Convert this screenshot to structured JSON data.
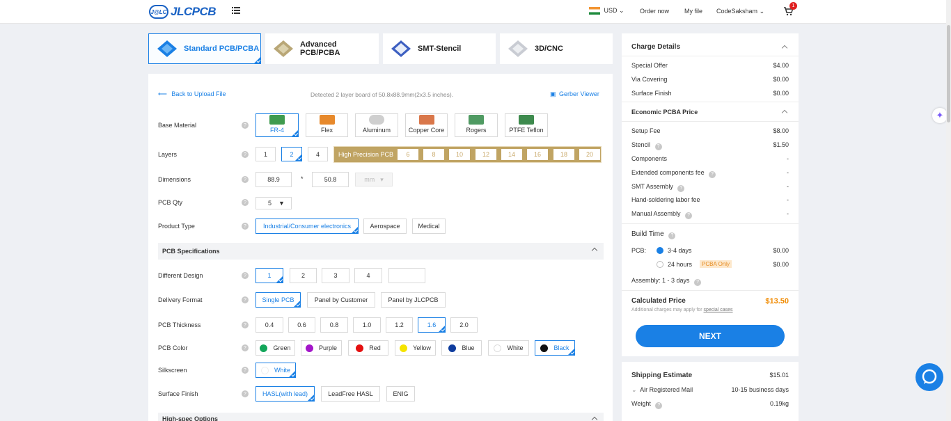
{
  "header": {
    "logo_badge": "J@LC",
    "logo_text": "JLCPCB",
    "currency": "USD",
    "order_now": "Order now",
    "my_file": "My file",
    "user": "CodeSaksham",
    "cart_count": "1"
  },
  "tabs": [
    "Standard PCB/PCBA",
    "Advanced PCB/PCBA",
    "SMT-Stencil",
    "3D/CNC"
  ],
  "upload": {
    "back": "Back to Upload File",
    "detected": "Detected 2 layer board of 50.8x88.9mm(2x3.5 inches).",
    "gerber": "Gerber Viewer"
  },
  "form": {
    "base_material": {
      "label": "Base Material",
      "options": [
        "FR-4",
        "Flex",
        "Aluminum",
        "Copper Core",
        "Rogers",
        "PTFE Teflon"
      ]
    },
    "layers": {
      "label": "Layers",
      "options": [
        "1",
        "2",
        "4"
      ],
      "hp_label": "High Precision PCB",
      "hp_options": [
        "6",
        "8",
        "10",
        "12",
        "14",
        "16",
        "18",
        "20"
      ]
    },
    "dimensions": {
      "label": "Dimensions",
      "x": "88.9",
      "sep": "*",
      "y": "50.8",
      "unit": "mm"
    },
    "qty": {
      "label": "PCB Qty",
      "value": "5"
    },
    "product_type": {
      "label": "Product Type",
      "options": [
        "Industrial/Consumer electronics",
        "Aerospace",
        "Medical"
      ]
    },
    "specs_title": "PCB Specifications",
    "different_design": {
      "label": "Different Design",
      "options": [
        "1",
        "2",
        "3",
        "4"
      ]
    },
    "delivery": {
      "label": "Delivery Format",
      "options": [
        "Single PCB",
        "Panel by Customer",
        "Panel by JLCPCB"
      ]
    },
    "thickness": {
      "label": "PCB Thickness",
      "options": [
        "0.4",
        "0.6",
        "0.8",
        "1.0",
        "1.2",
        "1.6",
        "2.0"
      ]
    },
    "color": {
      "label": "PCB Color",
      "options": [
        "Green",
        "Purple",
        "Red",
        "Yellow",
        "Blue",
        "White",
        "Black"
      ]
    },
    "silkscreen": {
      "label": "Silkscreen",
      "value": "White"
    },
    "surface": {
      "label": "Surface Finish",
      "options": [
        "HASL(with lead)",
        "LeadFree HASL",
        "ENIG"
      ]
    },
    "highspec_title": "High-spec Options"
  },
  "charge": {
    "title": "Charge Details",
    "rows": [
      [
        "Special Offer",
        "$4.00"
      ],
      [
        "Via Covering",
        "$0.00"
      ],
      [
        "Surface Finish",
        "$0.00"
      ]
    ],
    "pcba_title": "Economic PCBA Price",
    "pcba_rows": [
      [
        "Setup Fee",
        "$8.00"
      ],
      [
        "Stencil",
        "$1.50"
      ],
      [
        "Components",
        "-"
      ],
      [
        "Extended components fee",
        "-"
      ],
      [
        "SMT Assembly",
        "-"
      ],
      [
        "Hand-soldering labor fee",
        "-"
      ],
      [
        "Manual Assembly",
        "-"
      ]
    ],
    "build_title": "Build Time",
    "pcb_label": "PCB:",
    "build_opt1": "3-4 days",
    "build_price1": "$0.00",
    "build_opt2": "24 hours",
    "pcba_only": "PCBA Only",
    "build_price2": "$0.00",
    "assembly_label": "Assembly:",
    "assembly_value": "1 - 3 days",
    "calc_title": "Calculated Price",
    "calc_value": "$13.50",
    "note": "Additional charges may apply for",
    "note_link": "special cases",
    "next": "NEXT"
  },
  "shipping": {
    "title": "Shipping Estimate",
    "price": "$15.01",
    "method": "Air Registered Mail",
    "days": "10-15 business days",
    "weight_label": "Weight",
    "weight": "0.19kg"
  },
  "colors": {
    "accent": "#1a80e5",
    "price": "#f08a00",
    "hp": "#c0a463"
  }
}
